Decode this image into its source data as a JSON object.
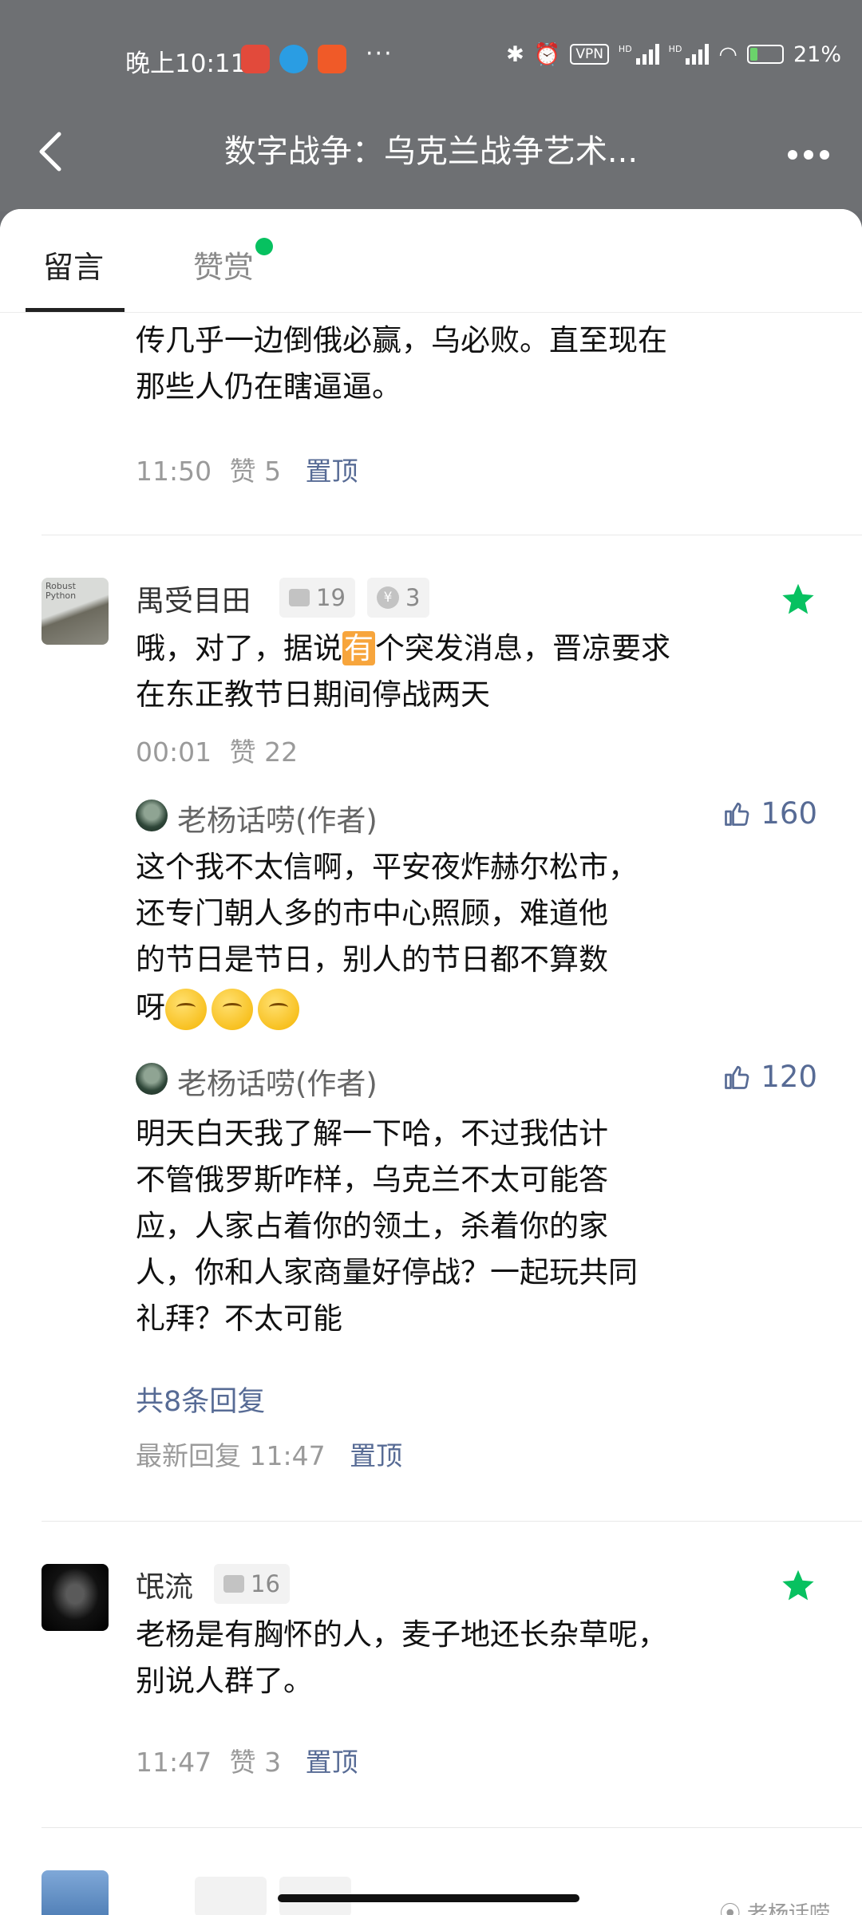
{
  "status_bar": {
    "time": "晚上10:11",
    "more": "···",
    "vpn": "VPN",
    "hd": "HD",
    "battery": "21%"
  },
  "header": {
    "back_icon": "chevron-left-icon",
    "title": "数字战争：乌克兰战争艺术...",
    "more_icon": "more-horizontal-icon"
  },
  "tabs": [
    {
      "label": "留言",
      "active": true
    },
    {
      "label": "赞赏",
      "active": false,
      "dot_color": "#07c160"
    }
  ],
  "partial_comment": {
    "lines": [
      "传几乎一边倒俄必赢，乌必败。直至现在",
      "那些人仍在瞎逼逼。"
    ],
    "time": "11:50",
    "likes_label": "赞 5",
    "pin_label": "置顶"
  },
  "comments": [
    {
      "name": "禺受目田",
      "avatar_text": "Robust Python",
      "comment_count": "19",
      "reward_count": "3",
      "text_before": "哦，对了，据说",
      "text_highlight": "有",
      "text_after": "个突发消息，晋凉要求",
      "text_line2": "在东正教节日期间停战两天",
      "time": "00:01",
      "likes_label": "赞 22",
      "replies": [
        {
          "name": "老杨话唠(作者)",
          "likes": "160",
          "lines": [
            "这个我不太信啊，平安夜炸赫尔松市，",
            "还专门朝人多的市中心照顾，难道他",
            "的节日是节日，别人的节日都不算数",
            "呀"
          ]
        },
        {
          "name": "老杨话唠(作者)",
          "likes": "120",
          "lines": [
            "明天白天我了解一下哈，不过我估计",
            "不管俄罗斯咋样，乌克兰不太可能答",
            "应，人家占着你的领土，杀着你的家",
            "人，你和人家商量好停战？一起玩共同",
            "礼拜？不太可能"
          ]
        }
      ],
      "more_replies": "共8条回复",
      "latest_reply": "最新回复 11:47",
      "pin_label": "置顶"
    },
    {
      "name": "氓流",
      "comment_count": "16",
      "lines": [
        "老杨是有胸怀的人，麦子地还长杂草呢，",
        "别说人群了。"
      ],
      "time": "11:47",
      "likes_label": "赞 3",
      "pin_label": "置顶"
    }
  ],
  "watermark": "老杨话唠",
  "colors": {
    "accent_green": "#07c160",
    "link_blue": "#576b95",
    "header_gray": "#6e7073"
  }
}
